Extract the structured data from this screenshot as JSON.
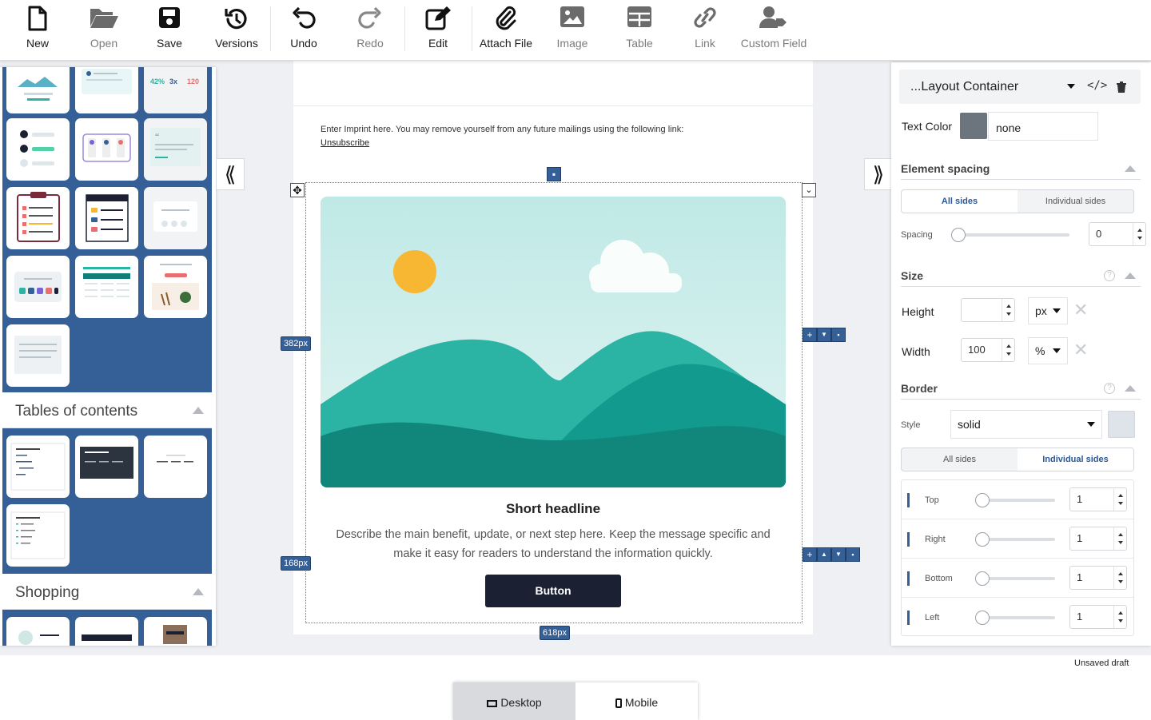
{
  "toolbar": {
    "new": "New",
    "open": "Open",
    "save": "Save",
    "versions": "Versions",
    "undo": "Undo",
    "redo": "Redo",
    "edit": "Edit",
    "attach": "Attach File",
    "image": "Image",
    "table": "Table",
    "link": "Link",
    "custom_field": "Custom Field"
  },
  "left_panel": {
    "sections": [
      "Tables of contents",
      "Shopping"
    ],
    "thumb_text": {
      "stat1": "42%",
      "stat2": "3x",
      "stat3": "120"
    }
  },
  "canvas": {
    "imprint_text": "Enter Imprint here. You may remove yourself from any future mailings using the following link:",
    "unsubscribe": "Unsubscribe",
    "headline": "Short headline",
    "body": "Describe the main benefit, update, or next step here. Keep the message specific and make it easy for readers to understand the information quickly.",
    "button": "Button",
    "dim_382": "382px",
    "dim_168": "168px",
    "dim_618": "618px"
  },
  "right_panel": {
    "container_name": "...Layout Container",
    "text_color_label": "Text Color",
    "text_color_value": "none",
    "element_spacing": "Element spacing",
    "all_sides": "All sides",
    "individual_sides": "Individual sides",
    "spacing_label": "Spacing",
    "spacing_value": "0",
    "size": "Size",
    "height_label": "Height",
    "height_value": "",
    "height_unit": "px",
    "width_label": "Width",
    "width_value": "100",
    "width_unit": "%",
    "border": "Border",
    "style_label": "Style",
    "style_value": "solid",
    "sides": [
      {
        "label": "Top",
        "value": "1"
      },
      {
        "label": "Right",
        "value": "1"
      },
      {
        "label": "Bottom",
        "value": "1"
      },
      {
        "label": "Left",
        "value": "1"
      }
    ]
  },
  "status": "Unsaved draft",
  "device": {
    "desktop": "Desktop",
    "mobile": "Mobile"
  },
  "colors": {
    "accent": "#356097",
    "dark_button": "#1b2133",
    "teal": "#2bb3a3",
    "sun": "#f7b733",
    "swatch": "#6c757d"
  }
}
